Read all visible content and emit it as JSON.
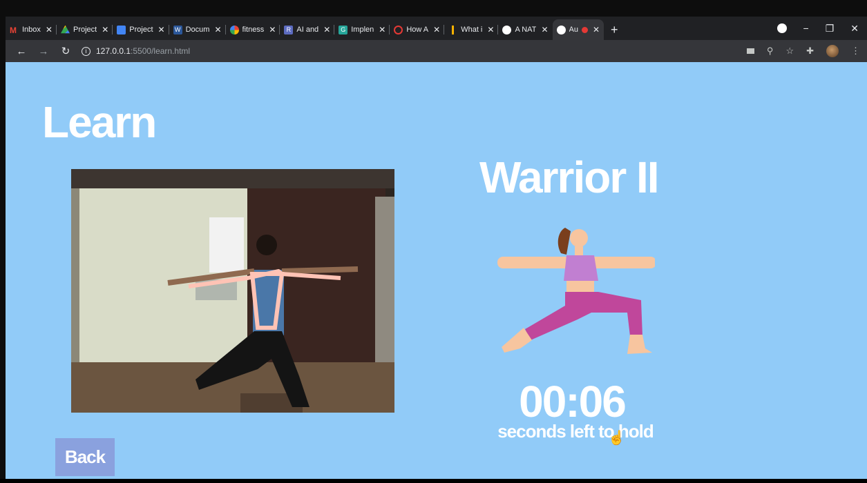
{
  "browser": {
    "tabs": [
      {
        "title": "Inbox",
        "color": "#ea4335",
        "icon": "gmail-icon"
      },
      {
        "title": "Project",
        "color": "#fbbc04",
        "icon": "drive-icon"
      },
      {
        "title": "Project",
        "color": "#4285f4",
        "icon": "docs-icon"
      },
      {
        "title": "Docum",
        "color": "#2b579a",
        "icon": "word-icon"
      },
      {
        "title": "fitness",
        "color": "#ffffff",
        "icon": "google-icon"
      },
      {
        "title": "AI and",
        "color": "#5c6bc0",
        "icon": "r-icon"
      },
      {
        "title": "Implen",
        "color": "#26a69a",
        "icon": "g-icon"
      },
      {
        "title": "How A",
        "color": "#e53935",
        "icon": "quora-icon"
      },
      {
        "title": "What i",
        "color": "#ffb300",
        "icon": "ruler-icon"
      },
      {
        "title": "A NAT",
        "color": "#ffffff",
        "icon": "globe-icon"
      },
      {
        "title": "Au",
        "color": "#ffffff",
        "icon": "globe-icon",
        "active": true
      }
    ],
    "new_tab": "+",
    "url_host": "127.0.0.1",
    "url_path": ":5500/learn.html"
  },
  "page": {
    "heading": "Learn",
    "pose_name": "Warrior II",
    "timer": "00:06",
    "hold_text": "seconds left to hold",
    "back_label": "Back"
  },
  "colors": {
    "background": "#91cbf8",
    "back_button": "#8aa1de",
    "skeleton": "#ffc3b5"
  }
}
